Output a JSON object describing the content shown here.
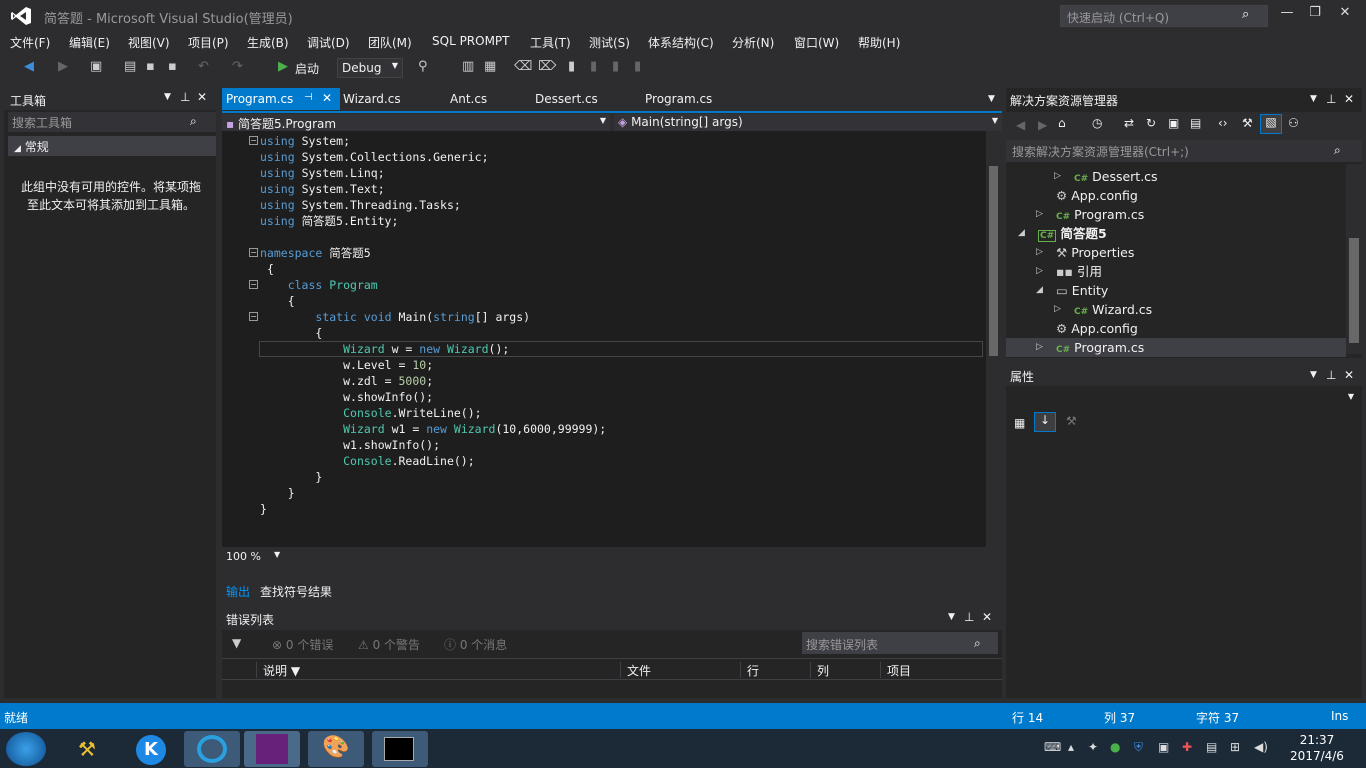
{
  "window": {
    "title": "简答题 - Microsoft Visual Studio(管理员)",
    "quick_launch_placeholder": "快速启动 (Ctrl+Q)"
  },
  "menu": [
    "文件(F)",
    "编辑(E)",
    "视图(V)",
    "项目(P)",
    "生成(B)",
    "调试(D)",
    "团队(M)",
    "SQL PROMPT",
    "工具(T)",
    "测试(S)",
    "体系结构(C)",
    "分析(N)",
    "窗口(W)",
    "帮助(H)"
  ],
  "toolbar": {
    "start_label": "启动",
    "config_value": "Debug"
  },
  "toolbox": {
    "title": "工具箱",
    "search_placeholder": "搜索工具箱",
    "group_label": "常规",
    "empty_message": "此组中没有可用的控件。将某项拖至此文本可将其添加到工具箱。"
  },
  "editor": {
    "tabs": [
      "Program.cs",
      "Wizard.cs",
      "Ant.cs",
      "Dessert.cs",
      "Program.cs"
    ],
    "nav_class": "简答题5.Program",
    "nav_member": "Main(string[] args)",
    "zoom": "100 %"
  },
  "code": {
    "using": "using",
    "using_lines": [
      "System;",
      "System.Collections.Generic;",
      "System.Linq;",
      "System.Text;",
      "System.Threading.Tasks;",
      "简答题5.Entity;"
    ],
    "namespace_kw": "namespace",
    "namespace_name": "简答题5",
    "class_kw": "class",
    "class_name": "Program",
    "static_kw": "static",
    "void_kw": "void",
    "main_sig": "Main(",
    "string_kw": "string",
    "main_args": "[] args)",
    "open_brace": "{",
    "close_brace": "}",
    "wizard_type": "Wizard",
    "new_kw": "new",
    "line_w_decl": " w = ",
    "line_w_decl_end": "();",
    "line_level": "w.Level = ",
    "level_val": "10",
    "line_zdl": "w.zdl = ",
    "zdl_val": "5000",
    "line_show": "w.showInfo();",
    "console_type": "Console",
    "line_writeline": ".WriteLine();",
    "line_w1_decl": " w1 = ",
    "line_w1_args": "(10,6000,99999);",
    "line_show1": "w1.showInfo();",
    "line_readline": ".ReadLine();",
    "semicolon": ";"
  },
  "output_panel": {
    "tab_output": "输出",
    "tab_find": "查找符号结果"
  },
  "error_list": {
    "title": "错误列表",
    "errors": "0 个错误",
    "warnings": "0 个警告",
    "messages": "0 个消息",
    "search_placeholder": "搜索错误列表",
    "columns": [
      "说明",
      "文件",
      "行",
      "列",
      "项目"
    ]
  },
  "solution_explorer": {
    "title": "解决方案资源管理器",
    "search_placeholder": "搜索解决方案资源管理器(Ctrl+;)",
    "cs_badge": "C#",
    "items": [
      "Dessert.cs",
      "App.config",
      "Program.cs",
      "简答题5",
      "Properties",
      "引用",
      "Entity",
      "Wizard.cs",
      "App.config",
      "Program.cs"
    ]
  },
  "properties": {
    "title": "属性"
  },
  "status": {
    "ready": "就绪",
    "line": "行 14",
    "col": "列 37",
    "char": "字符 37",
    "mode": "Ins"
  },
  "taskbar": {
    "time": "21:37",
    "date": "2017/4/6"
  },
  "colors": {
    "accent": "#007acc",
    "editor_bg": "#1e1e1e",
    "keyword": "#569cd6",
    "type": "#4ec9b0",
    "number": "#b5cea8"
  }
}
